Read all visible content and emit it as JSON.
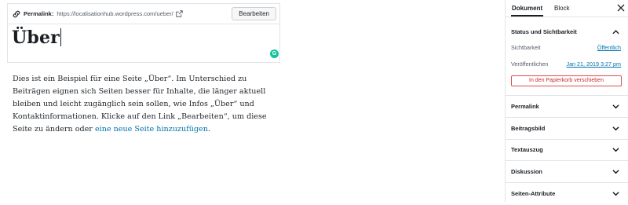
{
  "editor": {
    "permalink_label": "Permalink:",
    "permalink_url": "https://localisationhub.wordpress.com/ueber/",
    "edit_button": "Bearbeiten",
    "title": "Über",
    "content_text": "Dies ist ein Beispiel für eine Seite „Über“. Im Unterschied zu Beiträgen eignen sich Seiten besser für Inhalte, die länger aktuell bleiben und leicht zugänglich sein sollen, wie Infos „Über“ und Kontaktinformationen. Klicke auf den Link „Bearbeiten“, um diese Seite zu ändern oder ",
    "content_link": "eine neue Seite hinzuzufügen",
    "content_end": "."
  },
  "sidebar": {
    "tabs": [
      {
        "label": "Dokument",
        "active": true
      },
      {
        "label": "Block",
        "active": false
      }
    ],
    "status_panel": {
      "title": "Status und Sichtbarkeit",
      "visibility_label": "Sichtbarkeit",
      "visibility_value": "Öffentlich",
      "published_label": "Veröffentlichen",
      "published_value": "Jan 21, 2019 3:27 pm",
      "trash_button": "In den Papierkorb verschieben"
    },
    "panels": [
      "Permalink",
      "Beitragsbild",
      "Textauszug",
      "Diskussion",
      "Seiten-Attribute"
    ]
  },
  "colors": {
    "link": "#0073aa",
    "danger": "#c92c2c",
    "grammarly": "#15c39a",
    "border": "#e2e4e7"
  },
  "icons": [
    "link-icon",
    "external-link-icon",
    "grammarly-icon",
    "close-icon",
    "chevron-up-icon",
    "chevron-down-icon"
  ]
}
